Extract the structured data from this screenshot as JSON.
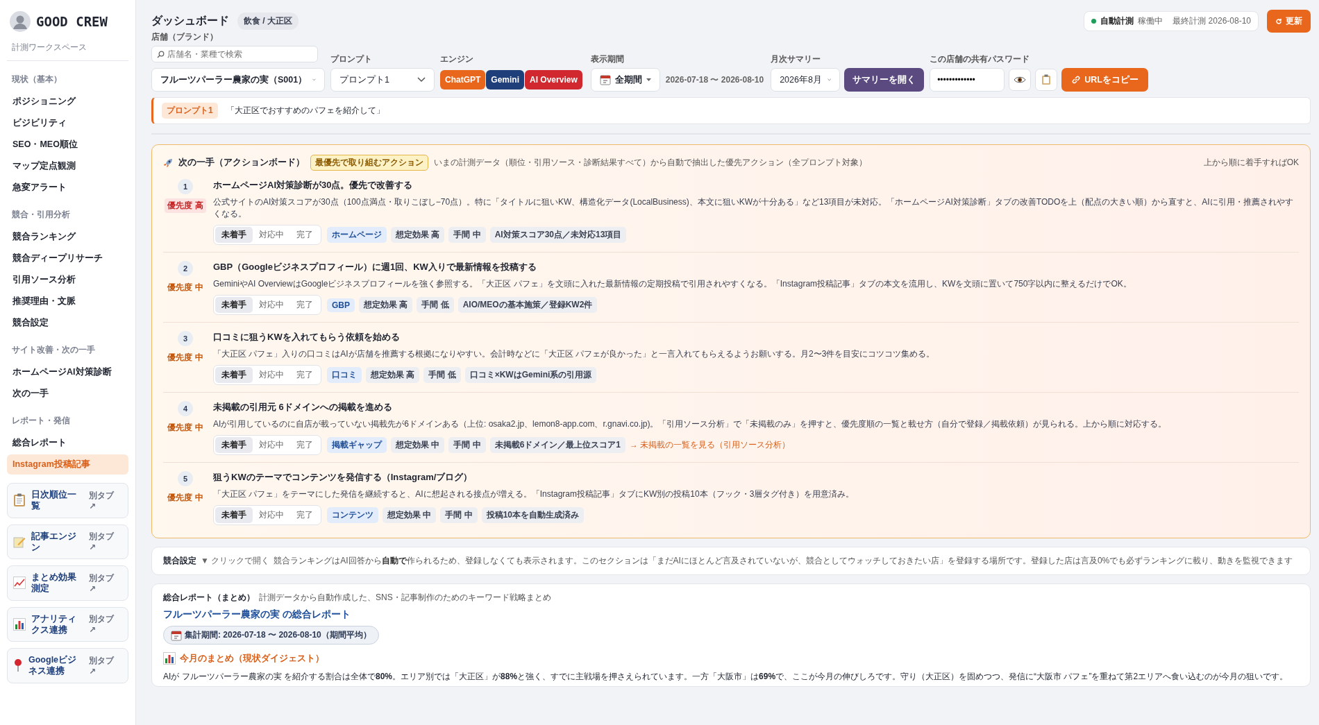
{
  "sidebar": {
    "logo": "GOOD CREW",
    "workspace": "計測ワークスペース",
    "sections": [
      {
        "heading": "現状（基本）",
        "items": [
          {
            "label": "ポジショニング",
            "selected": false
          },
          {
            "label": "ビジビリティ",
            "selected": false
          },
          {
            "label": "SEO・MEO順位",
            "selected": false
          },
          {
            "label": "マップ定点観測",
            "selected": false
          },
          {
            "label": "急変アラート",
            "selected": false
          }
        ]
      },
      {
        "heading": "競合・引用分析",
        "items": [
          {
            "label": "競合ランキング",
            "selected": false
          },
          {
            "label": "競合ディープリサーチ",
            "selected": false
          },
          {
            "label": "引用ソース分析",
            "selected": false
          },
          {
            "label": "推奨理由・文脈",
            "selected": false
          },
          {
            "label": "競合設定",
            "selected": false
          }
        ]
      },
      {
        "heading": "サイト改善・次の一手",
        "items": [
          {
            "label": "ホームページAI対策診断",
            "selected": false
          },
          {
            "label": "次の一手",
            "selected": false
          }
        ]
      },
      {
        "heading": "レポート・発信",
        "items": [
          {
            "label": "総合レポート",
            "selected": false
          },
          {
            "label": "Instagram投稿記事",
            "selected": true
          }
        ]
      }
    ],
    "external_links": [
      {
        "label": "日次順位一覧",
        "note": "別タブ ↗"
      },
      {
        "label": "記事エンジン",
        "note": "別タブ ↗"
      },
      {
        "label": "まとめ効果測定",
        "note": "別タブ ↗"
      },
      {
        "label": "アナリティクス連携",
        "note": "別タブ ↗"
      },
      {
        "label": "Googleビジネス連携",
        "note": "別タブ ↗"
      }
    ]
  },
  "header": {
    "title": "ダッシュボード",
    "category": "飲食 / 大正区",
    "status": {
      "label": "自動計測",
      "state": "稼働中",
      "last": "最終計測 2026-08-10",
      "color": "#1e9e5a"
    },
    "refresh": "更新"
  },
  "controls": {
    "store": {
      "label": "店舗（ブランド）",
      "placeholder": "店舗名・業種で検索",
      "value": "フルーツパーラー農家の実（S001）"
    },
    "prompt": {
      "label": "プロンプト",
      "value": "プロンプト1"
    },
    "engines": {
      "label": "エンジン",
      "items": [
        {
          "label": "ChatGPT",
          "color": "#e8671c",
          "selected": true
        },
        {
          "label": "Gemini",
          "color": "#1f3f7a",
          "selected": true
        },
        {
          "label": "AI Overview",
          "color": "#d0282e",
          "selected": true
        }
      ]
    },
    "period": {
      "label": "表示期間",
      "value": "全期間",
      "range": "2026-07-18 〜 2026-08-10"
    },
    "monthly": {
      "label": "月次サマリー",
      "value": "2026年8月",
      "button": "サマリーを開く"
    },
    "password": {
      "label": "この店舗の共有パスワード",
      "value": "•••••••••••••",
      "copy": "URLをコピー"
    }
  },
  "prompt_bar": {
    "tag": "プロンプト1",
    "text": "「大正区でおすすめのパフェを紹介して」"
  },
  "action_board": {
    "title": "次の一手（アクションボード）",
    "badge": "最優先で取り組むアクション",
    "description": "いまの計測データ（順位・引用ソース・診断結果すべて）から自動で抽出した優先アクション（全プロンプト対象）",
    "hint": "上から順に着手すればOK",
    "items": [
      {
        "number": "1",
        "priority": "優先度 高",
        "high_priority": true,
        "title": "ホームページAI対策診断が30点。優先で改善する",
        "description": "公式サイトのAI対策スコアが30点（100点満点・取りこぼし−70点）。特に「タイトルに狙いKW、構造化データ(LocalBusiness)、本文に狙いKWが十分ある」など13項目が未対応。「ホームページAI対策診断」タブの改善TODOを上（配点の大きい順）から直すと、AIに引用・推薦されやすくなる。",
        "statuses": [
          {
            "label": "未着手",
            "selected": true
          },
          {
            "label": "対応中",
            "selected": false
          },
          {
            "label": "完了",
            "selected": false
          }
        ],
        "tags": [
          {
            "label": "ホームページ",
            "kind": "category"
          },
          {
            "label": "想定効果 高",
            "kind": "meta"
          },
          {
            "label": "手間 中",
            "kind": "meta"
          },
          {
            "label": "AI対策スコア30点／未対応13項目",
            "kind": "meta"
          }
        ]
      },
      {
        "number": "2",
        "priority": "優先度 中",
        "high_priority": false,
        "title": "GBP（Googleビジネスプロフィール）に週1回、KW入りで最新情報を投稿する",
        "description": "GeminiやAI OverviewはGoogleビジネスプロフィールを強く参照する。「大正区 パフェ」を文頭に入れた最新情報の定期投稿で引用されやすくなる。「Instagram投稿記事」タブの本文を流用し、KWを文頭に置いて750字以内に整えるだけでOK。",
        "statuses": [
          {
            "label": "未着手",
            "selected": true
          },
          {
            "label": "対応中",
            "selected": false
          },
          {
            "label": "完了",
            "selected": false
          }
        ],
        "tags": [
          {
            "label": "GBP",
            "kind": "category"
          },
          {
            "label": "想定効果 高",
            "kind": "meta"
          },
          {
            "label": "手間 低",
            "kind": "meta"
          },
          {
            "label": "AIO/MEOの基本施策／登録KW2件",
            "kind": "meta"
          }
        ]
      },
      {
        "number": "3",
        "priority": "優先度 中",
        "high_priority": false,
        "title": "口コミに狙うKWを入れてもらう依頼を始める",
        "description": "「大正区 パフェ」入りの口コミはAIが店舗を推薦する根拠になりやすい。会計時などに「大正区 パフェが良かった」と一言入れてもらえるようお願いする。月2〜3件を目安にコツコツ集める。",
        "statuses": [
          {
            "label": "未着手",
            "selected": true
          },
          {
            "label": "対応中",
            "selected": false
          },
          {
            "label": "完了",
            "selected": false
          }
        ],
        "tags": [
          {
            "label": "口コミ",
            "kind": "category"
          },
          {
            "label": "想定効果 高",
            "kind": "meta"
          },
          {
            "label": "手間 低",
            "kind": "meta"
          },
          {
            "label": "口コミ×KWはGemini系の引用源",
            "kind": "meta"
          }
        ]
      },
      {
        "number": "4",
        "priority": "優先度 中",
        "high_priority": false,
        "title": "未掲載の引用元 6ドメインへの掲載を進める",
        "description": "AIが引用しているのに自店が載っていない掲載先が6ドメインある（上位: osaka2.jp、lemon8-app.com、r.gnavi.co.jp)。「引用ソース分析」で「未掲載のみ」を押すと、優先度順の一覧と載せ方（自分で登録／掲載依頼）が見られる。上から順に対応する。",
        "statuses": [
          {
            "label": "未着手",
            "selected": true
          },
          {
            "label": "対応中",
            "selected": false
          },
          {
            "label": "完了",
            "selected": false
          }
        ],
        "tags": [
          {
            "label": "掲載ギャップ",
            "kind": "category"
          },
          {
            "label": "想定効果 中",
            "kind": "meta"
          },
          {
            "label": "手間 中",
            "kind": "meta"
          },
          {
            "label": "未掲載6ドメイン／最上位スコア1",
            "kind": "meta"
          }
        ],
        "link": "→ 未掲載の一覧を見る（引用ソース分析）"
      },
      {
        "number": "5",
        "priority": "優先度 中",
        "high_priority": false,
        "title": "狙うKWのテーマでコンテンツを発信する（Instagram/ブログ）",
        "description": "「大正区 パフェ」をテーマにした発信を継続すると、AIに想起される接点が増える。「Instagram投稿記事」タブにKW別の投稿10本（フック・3層タグ付き）を用意済み。",
        "statuses": [
          {
            "label": "未着手",
            "selected": true
          },
          {
            "label": "対応中",
            "selected": false
          },
          {
            "label": "完了",
            "selected": false
          }
        ],
        "tags": [
          {
            "label": "コンテンツ",
            "kind": "category"
          },
          {
            "label": "想定効果 中",
            "kind": "meta"
          },
          {
            "label": "手間 中",
            "kind": "meta"
          },
          {
            "label": "投稿10本を自動生成済み",
            "kind": "meta"
          }
        ]
      }
    ]
  },
  "competitor_settings": {
    "title": "競合設定",
    "toggle": "▼ クリックで開く",
    "text": "競合ランキングはAI回答から**自動で**作られるため、登録しなくても表示されます。このセクションは「まだAIにほとんど言及されていないが、競合としてウォッチしておきたい店」を登録する場所です。登録した店は言及0%でも必ずランキングに載り、動きを監視できます"
  },
  "report": {
    "title": "総合レポート（まとめ）",
    "subtitle": "計測データから自動作成した、SNS・記事制作のためのキーワード戦略まとめ",
    "link": "フルーツパーラー農家の実 の総合レポート",
    "period": "集計期間: 2026-07-18 〜 2026-08-10（期間平均）",
    "summary_heading": "今月のまとめ（現状ダイジェスト）",
    "summary": "AIが フルーツパーラー農家の実 を紹介する割合は全体で**80%**。エリア別では「大正区」が**88%**と強く、すでに主戦場を押さえられています。一方「大阪市」は**69%**で、ここが今月の伸びしろです。守り（大正区）を固めつつ、発信に“大阪市 パフェ”を重ねて第2エリアへ食い込むのが今月の狙いです。"
  }
}
